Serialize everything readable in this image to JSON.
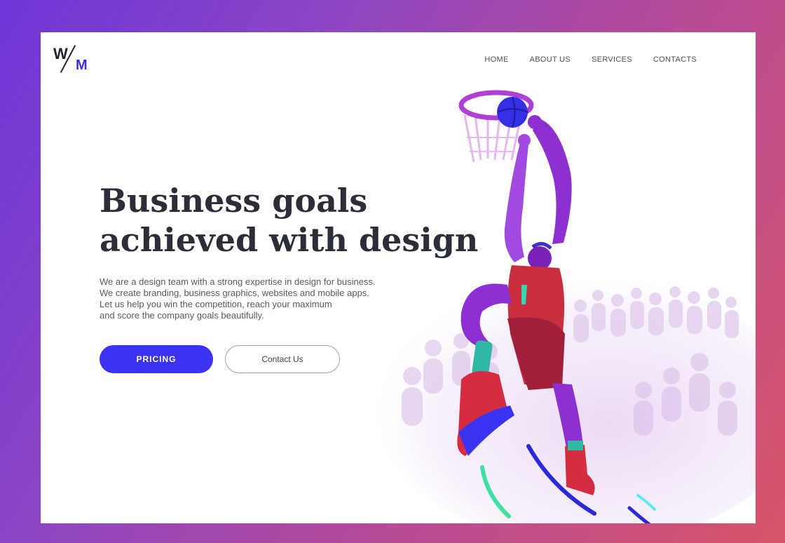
{
  "logo": {
    "w": "W",
    "m": "M"
  },
  "nav": {
    "home": "HOME",
    "about": "ABOUT US",
    "services": "SERVICES",
    "contacts": "CONTACTS"
  },
  "hero": {
    "title_line1": "Business goals",
    "title_line2": "achieved with design",
    "desc_line1": "We are a design team with a strong expertise in design for business.",
    "desc_line2": "We create branding, business graphics, websites and mobile apps.",
    "desc_line3": "Let us help you win the competition, reach your maximum",
    "desc_line4": "and score the company goals beautifully."
  },
  "buttons": {
    "pricing": "PRICING",
    "contact": "Contact Us"
  },
  "colors": {
    "accent": "#3b33f2",
    "text_dark": "#2b2e38",
    "gradient_start": "#6f36d8",
    "gradient_end": "#d75468"
  },
  "icons": {
    "illustration": "basketball-player-illustration"
  }
}
